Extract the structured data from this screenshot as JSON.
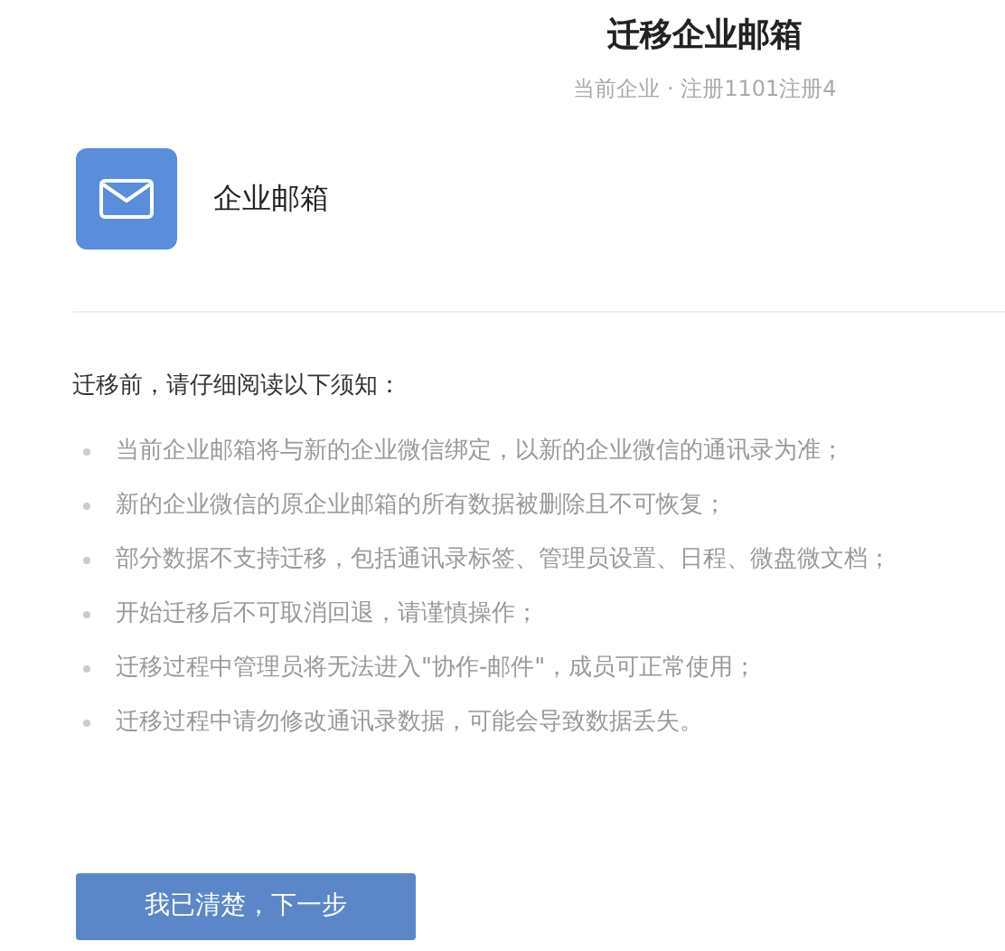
{
  "header": {
    "title": "迁移企业邮箱",
    "subtitle": "当前企业 · 注册1101注册4"
  },
  "app": {
    "name": "企业邮箱"
  },
  "notice": {
    "heading": "迁移前，请仔细阅读以下须知：",
    "items": [
      "当前企业邮箱将与新的企业微信绑定，以新的企业微信的通讯录为准；",
      "新的企业微信的原企业邮箱的所有数据被删除且不可恢复；",
      "部分数据不支持迁移，包括通讯录标签、管理员设置、日程、微盘微文档；",
      "开始迁移后不可取消回退，请谨慎操作；",
      "迁移过程中管理员将无法进入\"协作-邮件\"，成员可正常使用；",
      "迁移过程中请勿修改通讯录数据，可能会导致数据丢失。"
    ]
  },
  "button": "我已清楚，下一步"
}
